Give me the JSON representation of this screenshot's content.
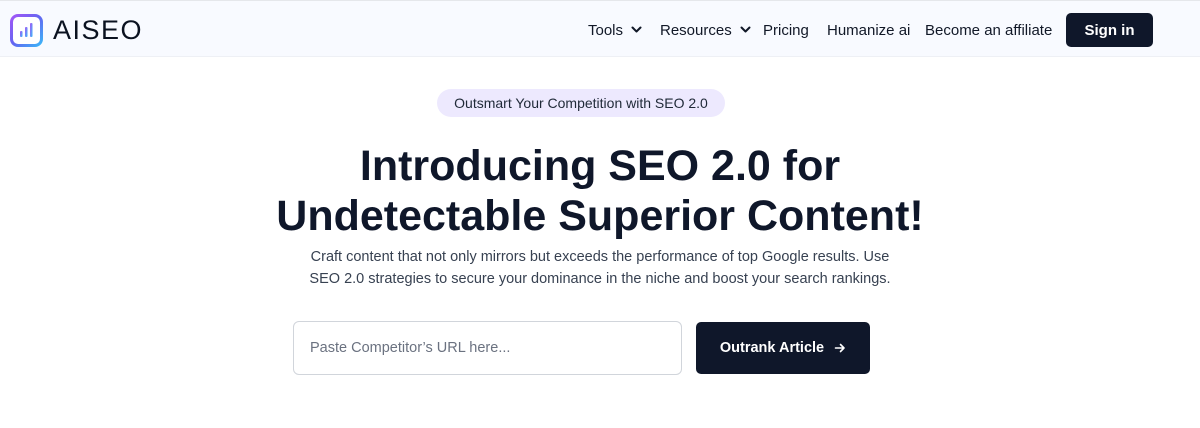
{
  "brand": {
    "name": "AISEO",
    "logo_icon": "bar-chart-logo-icon",
    "gradient": [
      "#a855f7",
      "#6366f1",
      "#38bdf8"
    ]
  },
  "nav": {
    "items": [
      {
        "label": "Tools",
        "has_dropdown": true
      },
      {
        "label": "Resources",
        "has_dropdown": true
      },
      {
        "label": "Pricing",
        "has_dropdown": false
      },
      {
        "label": "Humanize ai",
        "has_dropdown": false
      },
      {
        "label": "Become an affiliate",
        "has_dropdown": false
      }
    ],
    "signin_label": "Sign in"
  },
  "hero": {
    "pill": "Outsmart Your Competition with SEO 2.0",
    "headline_line1": "Introducing SEO 2.0 for",
    "headline_line2": "Undetectable Superior Content!",
    "subtext_line1": "Craft content that not only mirrors but exceeds the performance of top Google results. Use",
    "subtext_line2": "SEO 2.0 strategies to secure your dominance in the niche and boost your search rankings."
  },
  "form": {
    "url_placeholder": "Paste Competitor’s URL here...",
    "url_value": "",
    "submit_label": "Outrank Article",
    "submit_icon": "arrow-right-icon"
  },
  "colors": {
    "primary_dark": "#0f172a",
    "pill_bg": "#ede9fe",
    "header_bg": "#f8faff"
  }
}
